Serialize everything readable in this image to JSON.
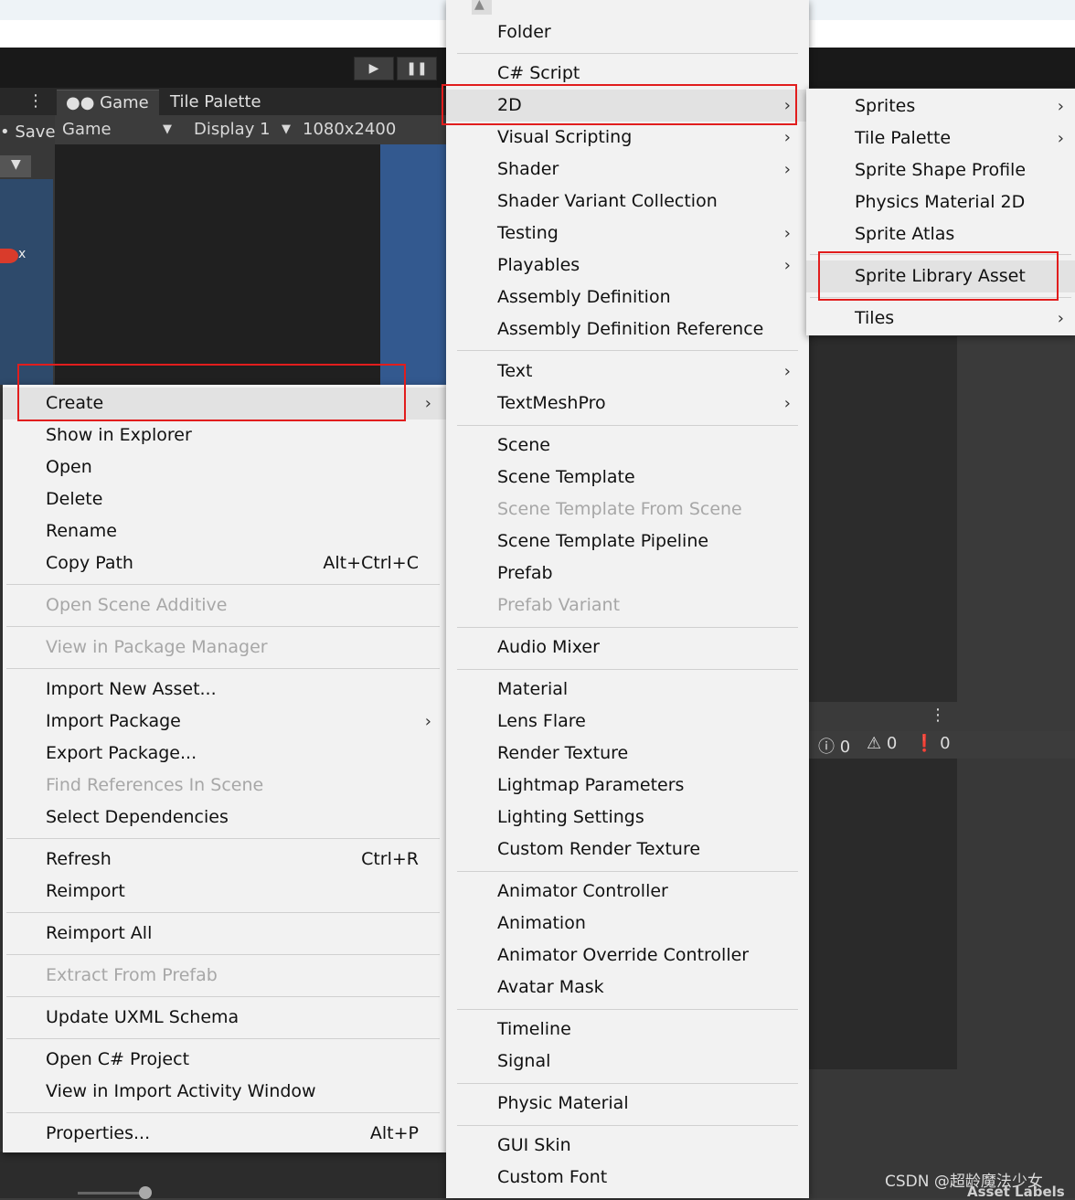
{
  "toolbar": {
    "play_icon": "play-icon",
    "pause_icon": "pause-icon"
  },
  "tabs": {
    "game": "Game",
    "tile_palette": "Tile Palette"
  },
  "game_bar": {
    "mode": "Game",
    "display": "Display 1",
    "resolution": "1080x2400"
  },
  "left_panel": {
    "save": "Save",
    "axis_label": "x"
  },
  "context_menu": {
    "items": [
      {
        "label": "Create",
        "shortcut": "",
        "submenu": true,
        "disabled": false,
        "highlighted": true
      },
      {
        "label": "Show in Explorer",
        "shortcut": "",
        "submenu": false,
        "disabled": false
      },
      {
        "label": "Open",
        "shortcut": "",
        "submenu": false,
        "disabled": false
      },
      {
        "label": "Delete",
        "shortcut": "",
        "submenu": false,
        "disabled": false
      },
      {
        "label": "Rename",
        "shortcut": "",
        "submenu": false,
        "disabled": false
      },
      {
        "label": "Copy Path",
        "shortcut": "Alt+Ctrl+C",
        "submenu": false,
        "disabled": false
      },
      {
        "label": "Open Scene Additive",
        "shortcut": "",
        "submenu": false,
        "disabled": true
      },
      {
        "label": "View in Package Manager",
        "shortcut": "",
        "submenu": false,
        "disabled": true
      },
      {
        "label": "Import New Asset...",
        "shortcut": "",
        "submenu": false,
        "disabled": false
      },
      {
        "label": "Import Package",
        "shortcut": "",
        "submenu": true,
        "disabled": false
      },
      {
        "label": "Export Package...",
        "shortcut": "",
        "submenu": false,
        "disabled": false
      },
      {
        "label": "Find References In Scene",
        "shortcut": "",
        "submenu": false,
        "disabled": true
      },
      {
        "label": "Select Dependencies",
        "shortcut": "",
        "submenu": false,
        "disabled": false
      },
      {
        "label": "Refresh",
        "shortcut": "Ctrl+R",
        "submenu": false,
        "disabled": false
      },
      {
        "label": "Reimport",
        "shortcut": "",
        "submenu": false,
        "disabled": false
      },
      {
        "label": "Reimport All",
        "shortcut": "",
        "submenu": false,
        "disabled": false
      },
      {
        "label": "Extract From Prefab",
        "shortcut": "",
        "submenu": false,
        "disabled": true
      },
      {
        "label": "Update UXML Schema",
        "shortcut": "",
        "submenu": false,
        "disabled": false
      },
      {
        "label": "Open C# Project",
        "shortcut": "",
        "submenu": false,
        "disabled": false
      },
      {
        "label": "View in Import Activity Window",
        "shortcut": "",
        "submenu": false,
        "disabled": false
      },
      {
        "label": "Properties...",
        "shortcut": "Alt+P",
        "submenu": false,
        "disabled": false
      }
    ]
  },
  "create_menu": {
    "items": [
      {
        "label": "Folder",
        "submenu": false,
        "disabled": false
      },
      {
        "label": "C# Script",
        "submenu": false,
        "disabled": false
      },
      {
        "label": "2D",
        "submenu": true,
        "disabled": false,
        "highlighted": true
      },
      {
        "label": "Visual Scripting",
        "submenu": true,
        "disabled": false
      },
      {
        "label": "Shader",
        "submenu": true,
        "disabled": false
      },
      {
        "label": "Shader Variant Collection",
        "submenu": false,
        "disabled": false
      },
      {
        "label": "Testing",
        "submenu": true,
        "disabled": false
      },
      {
        "label": "Playables",
        "submenu": true,
        "disabled": false
      },
      {
        "label": "Assembly Definition",
        "submenu": false,
        "disabled": false
      },
      {
        "label": "Assembly Definition Reference",
        "submenu": false,
        "disabled": false
      },
      {
        "label": "Text",
        "submenu": true,
        "disabled": false
      },
      {
        "label": "TextMeshPro",
        "submenu": true,
        "disabled": false
      },
      {
        "label": "Scene",
        "submenu": false,
        "disabled": false
      },
      {
        "label": "Scene Template",
        "submenu": false,
        "disabled": false
      },
      {
        "label": "Scene Template From Scene",
        "submenu": false,
        "disabled": true
      },
      {
        "label": "Scene Template Pipeline",
        "submenu": false,
        "disabled": false
      },
      {
        "label": "Prefab",
        "submenu": false,
        "disabled": false
      },
      {
        "label": "Prefab Variant",
        "submenu": false,
        "disabled": true
      },
      {
        "label": "Audio Mixer",
        "submenu": false,
        "disabled": false
      },
      {
        "label": "Material",
        "submenu": false,
        "disabled": false
      },
      {
        "label": "Lens Flare",
        "submenu": false,
        "disabled": false
      },
      {
        "label": "Render Texture",
        "submenu": false,
        "disabled": false
      },
      {
        "label": "Lightmap Parameters",
        "submenu": false,
        "disabled": false
      },
      {
        "label": "Lighting Settings",
        "submenu": false,
        "disabled": false
      },
      {
        "label": "Custom Render Texture",
        "submenu": false,
        "disabled": false
      },
      {
        "label": "Animator Controller",
        "submenu": false,
        "disabled": false
      },
      {
        "label": "Animation",
        "submenu": false,
        "disabled": false
      },
      {
        "label": "Animator Override Controller",
        "submenu": false,
        "disabled": false
      },
      {
        "label": "Avatar Mask",
        "submenu": false,
        "disabled": false
      },
      {
        "label": "Timeline",
        "submenu": false,
        "disabled": false
      },
      {
        "label": "Signal",
        "submenu": false,
        "disabled": false
      },
      {
        "label": "Physic Material",
        "submenu": false,
        "disabled": false
      },
      {
        "label": "GUI Skin",
        "submenu": false,
        "disabled": false
      },
      {
        "label": "Custom Font",
        "submenu": false,
        "disabled": false
      }
    ]
  },
  "submenu_2d": {
    "items": [
      {
        "label": "Sprites",
        "submenu": true,
        "highlighted": false
      },
      {
        "label": "Tile Palette",
        "submenu": true,
        "highlighted": false
      },
      {
        "label": "Sprite Shape Profile",
        "submenu": false,
        "highlighted": false
      },
      {
        "label": "Physics Material 2D",
        "submenu": false,
        "highlighted": false
      },
      {
        "label": "Sprite Atlas",
        "submenu": false,
        "highlighted": false
      },
      {
        "label": "Sprite Library Asset",
        "submenu": false,
        "highlighted": true
      },
      {
        "label": "Tiles",
        "submenu": true,
        "highlighted": false
      }
    ]
  },
  "console": {
    "info_count": "0",
    "warning_count": "0",
    "error_count": "0"
  },
  "watermark": "CSDN @超龄魔法少女",
  "asset_labels": "Asset Labels",
  "colors": {
    "highlight_box": "#e11d1d",
    "menu_bg": "#f2f2f2",
    "disabled_text": "#a7a7a7"
  }
}
